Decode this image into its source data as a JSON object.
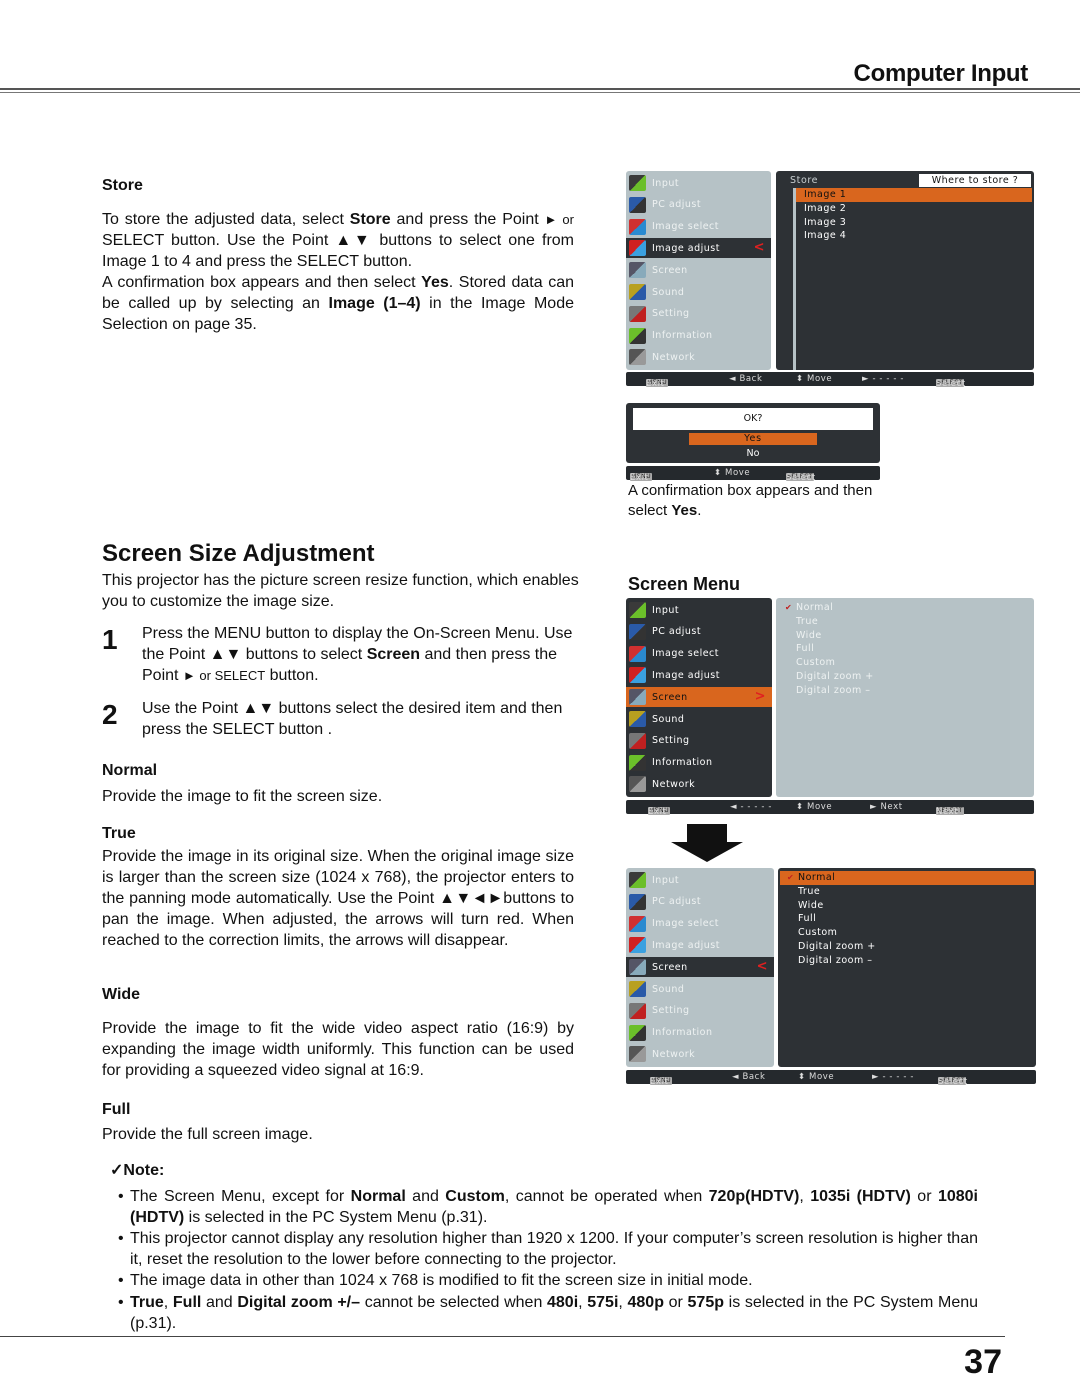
{
  "header": {
    "title": "Computer Input"
  },
  "store_section": {
    "heading": "Store",
    "para1_parts": [
      "To store the adjusted data, select ",
      "Store",
      " and press the Point ",
      "►",
      " or ",
      "SELECT button. Use the Point ▲▼ buttons to select one from Image 1 to 4 and press the SELECT button."
    ],
    "para2_parts": [
      "A confirmation box appears and then select ",
      "Yes",
      ". Stored data can be called up by selecting an ",
      "Image (1–4)",
      " in the Image Mode Selection on page 35."
    ]
  },
  "osd_store": {
    "menu_items": [
      {
        "label": "Input",
        "icon": "input-icon"
      },
      {
        "label": "PC adjust",
        "icon": "pc-adjust-icon"
      },
      {
        "label": "Image select",
        "icon": "image-select-icon"
      },
      {
        "label": "Image adjust",
        "icon": "image-adjust-icon",
        "selected": true
      },
      {
        "label": "Screen",
        "icon": "screen-icon"
      },
      {
        "label": "Sound",
        "icon": "sound-icon"
      },
      {
        "label": "Setting",
        "icon": "setting-icon"
      },
      {
        "label": "Information",
        "icon": "information-icon"
      },
      {
        "label": "Network",
        "icon": "network-icon"
      }
    ],
    "submenu_title": "Store",
    "submenu_prompt": "Where to store ?",
    "options": [
      "Image 1",
      "Image 2",
      "Image 3",
      "Image 4"
    ],
    "highlighted_option": "Image 1",
    "bar": {
      "menu_key": "MENU",
      "exit": "Exit",
      "back": "◄ Back",
      "move": "⬍ Move",
      "next": "► - - - - -",
      "select_key": "SELECT",
      "select": "Select"
    }
  },
  "osd_confirm": {
    "prompt": "OK?",
    "options": [
      "Yes",
      "No"
    ],
    "highlighted_option": "Yes",
    "bar": {
      "menu_key": "MENU",
      "exit": "Exit",
      "move": "⬍ Move",
      "select_key": "SELECT",
      "select": "Select"
    }
  },
  "confirm_caption_parts": [
    "A confirmation box appears and then select ",
    "Yes",
    "."
  ],
  "screen_size": {
    "heading": "Screen Size Adjustment",
    "intro": "This projector has the picture screen resize function, which enables you to customize the image size.",
    "steps": [
      {
        "num": "1",
        "parts": [
          "Press the MENU button to display the On-Screen Menu. Use the Point ▲▼ buttons to select ",
          "Screen",
          " and then press the Point ",
          "► or SELECT",
          " button."
        ]
      },
      {
        "num": "2",
        "text": "Use the Point ▲▼ buttons select the desired item and then press the SELECT button ."
      }
    ],
    "items": [
      {
        "heading": "Normal",
        "text": "Provide the image to fit the screen size."
      },
      {
        "heading": "True",
        "text": "Provide the image in its original size. When the original image size is larger than the screen size (1024 x 768), the projector enters to the panning mode automatically. Use the Point ▲▼◄►buttons to pan the image. When adjusted, the arrows will turn red. When reached to the correction limits, the arrows will disappear."
      },
      {
        "heading": "Wide",
        "text": "Provide the image to fit the wide video aspect ratio (16:9) by expanding the image width uniformly. This function can be used for providing a squeezed video signal at 16:9."
      },
      {
        "heading": "Full",
        "text": "Provide the full screen image."
      }
    ]
  },
  "screen_menu": {
    "title": "Screen Menu",
    "menu_items": [
      {
        "label": "Input"
      },
      {
        "label": "PC adjust"
      },
      {
        "label": "Image select"
      },
      {
        "label": "Image adjust"
      },
      {
        "label": "Screen",
        "selected": true
      },
      {
        "label": "Sound"
      },
      {
        "label": "Setting"
      },
      {
        "label": "Information"
      },
      {
        "label": "Network"
      }
    ],
    "options": [
      "Normal",
      "True",
      "Wide",
      "Full",
      "Custom",
      "Digital zoom +",
      "Digital zoom –"
    ],
    "checked_option": "Normal",
    "bar": {
      "menu_key": "MENU",
      "exit": "Exit",
      "back": "◄ - - - - -",
      "move": "⬍ Move",
      "next": "► Next",
      "select_key": "SELECT",
      "select": "Next"
    }
  },
  "screen_menu2": {
    "menu_items": [
      {
        "label": "Input"
      },
      {
        "label": "PC adjust"
      },
      {
        "label": "Image select"
      },
      {
        "label": "Image adjust"
      },
      {
        "label": "Screen",
        "selected": true
      },
      {
        "label": "Sound"
      },
      {
        "label": "Setting"
      },
      {
        "label": "Information"
      },
      {
        "label": "Network"
      }
    ],
    "options": [
      "Normal",
      "True",
      "Wide",
      "Full",
      "Custom",
      "Digital zoom +",
      "Digital zoom –"
    ],
    "highlighted_option": "Normal",
    "bar": {
      "menu_key": "MENU",
      "exit": "Exit",
      "back": "◄ Back",
      "move": "⬍ Move",
      "next": "► - - - - -",
      "select_key": "SELECT",
      "select": "Select"
    }
  },
  "note": {
    "title": "✓Note:",
    "items": [
      {
        "parts": [
          [
            "The Screen Menu, except for ",
            false
          ],
          [
            "Normal",
            true
          ],
          [
            " and ",
            false
          ],
          [
            "Custom",
            true
          ],
          [
            ", cannot be operated when ",
            false
          ],
          [
            "720p(HDTV)",
            true
          ],
          [
            ", ",
            false
          ],
          [
            "1035i (HDTV)",
            true
          ],
          [
            " or ",
            false
          ],
          [
            "1080i (HDTV)",
            true
          ],
          [
            "  is selected in the PC System Menu (p.31).",
            false
          ]
        ]
      },
      {
        "parts": [
          [
            "This projector cannot display any resolution higher than 1920 x 1200. If your computer’s screen resolution is higher than it, reset the resolution to the lower before connecting to the projector.",
            false
          ]
        ]
      },
      {
        "parts": [
          [
            "The image data in other than 1024 x 768 is modified to fit the screen size in initial mode.",
            false
          ]
        ]
      },
      {
        "parts": [
          [
            "True",
            true
          ],
          [
            ", ",
            false
          ],
          [
            "Full",
            true
          ],
          [
            " and ",
            false
          ],
          [
            "Digital zoom +/–",
            true
          ],
          [
            " cannot be selected when ",
            false
          ],
          [
            "480i",
            true
          ],
          [
            ", ",
            false
          ],
          [
            "575i",
            true
          ],
          [
            ", ",
            false
          ],
          [
            "480p",
            true
          ],
          [
            " or ",
            false
          ],
          [
            "575p",
            true
          ],
          [
            " is selected in the PC System Menu (p.31).",
            false
          ]
        ]
      }
    ]
  },
  "page_number": "37",
  "colors": {
    "osd_dark": "#2d3135",
    "osd_light": "#b6c2c6",
    "osd_highlight": "#d9661e",
    "caret_red": "#e02020"
  }
}
